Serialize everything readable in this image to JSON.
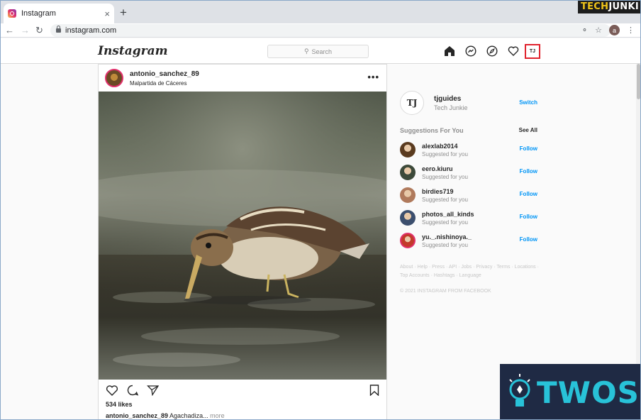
{
  "browser": {
    "tab_title": "Instagram",
    "tab_close": "×",
    "new_tab": "+",
    "url": "instagram.com",
    "profile_initial": "a",
    "brand_main": "TECH",
    "brand_accent": "JUNKI"
  },
  "ig": {
    "logo": "Instagram",
    "search_placeholder": "Search",
    "profile_initials": "TJ"
  },
  "post": {
    "username": "antonio_sanchez_89",
    "location": "Malpartida de Cáceres",
    "more": "•••",
    "likes": "534 likes",
    "caption_user": "antonio_sanchez_89",
    "caption_text": " Agachadiza...",
    "caption_more": " more"
  },
  "sidebar": {
    "username": "tjguides",
    "fullname": "Tech Junkie",
    "avatar_initials": "TJ",
    "switch": "Switch",
    "suggestions_title": "Suggestions For You",
    "see_all": "See All",
    "suggestions": [
      {
        "name": "alexlab2014",
        "sub": "Suggested for you",
        "action": "Follow",
        "color": "#5a3b1f"
      },
      {
        "name": "eero.kiuru",
        "sub": "Suggested for you",
        "action": "Follow",
        "color": "#3d4a3a"
      },
      {
        "name": "birdies719",
        "sub": "Suggested for you",
        "action": "Follow",
        "color": "#b07a5c"
      },
      {
        "name": "photos_all_kinds",
        "sub": "Suggested for you",
        "action": "Follow",
        "color": "#3c4f6e"
      },
      {
        "name": "yu._.nishinoya._",
        "sub": "Suggested for you",
        "action": "Follow",
        "color": "#c23a2a"
      }
    ],
    "footer_line1": "About · Help · Press · API · Jobs · Privacy · Terms · Locations ·",
    "footer_line2": "Top Accounts · Hashtags · Language",
    "copyright": "© 2021 INSTAGRAM FROM FACEBOOK"
  },
  "watermark": {
    "text": "TWOS"
  }
}
